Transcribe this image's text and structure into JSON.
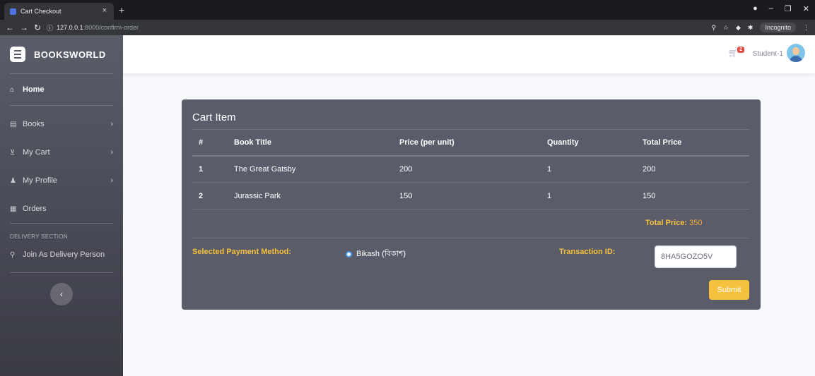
{
  "browser": {
    "tab_title": "Cart Checkout",
    "url_host": "127.0.0.1",
    "url_path": ":8000/confirm-order",
    "incognito_label": "Incognito"
  },
  "sidebar": {
    "brand": "BOOKSWORLD",
    "items": [
      {
        "label": "Home",
        "icon": "home-icon",
        "active": true
      },
      {
        "label": "Books",
        "icon": "book-icon"
      },
      {
        "label": "My Cart",
        "icon": "cart-icon"
      },
      {
        "label": "My Profile",
        "icon": "user-icon"
      },
      {
        "label": "Orders",
        "icon": "table-icon"
      }
    ],
    "section_heading": "DELIVERY SECTION",
    "delivery_item": {
      "label": "Join As Delivery Person",
      "icon": "bicycle-icon"
    }
  },
  "topbar": {
    "cart_count": "2",
    "user_name": "Student-1"
  },
  "cart": {
    "title": "Cart Item",
    "columns": [
      "#",
      "Book Title",
      "Price (per unit)",
      "Quantity",
      "Total Price"
    ],
    "rows": [
      {
        "num": "1",
        "title": "The Great Gatsby",
        "price": "200",
        "quantity": "1",
        "total": "200"
      },
      {
        "num": "2",
        "title": "Jurassic Park",
        "price": "150",
        "quantity": "1",
        "total": "150"
      }
    ],
    "total_label": "Total Price:",
    "total_value": "350"
  },
  "payment": {
    "label": "Selected Payment Method:",
    "method": "Bikash (বিকাশ)",
    "transaction_label": "Transaction ID:",
    "transaction_value": "8HA5GOZO5V",
    "submit_label": "Submit"
  },
  "colors": {
    "sidebar_top": "#5a5c69",
    "accent_yellow": "#f6c23e",
    "card_bg": "#5a5c69"
  }
}
